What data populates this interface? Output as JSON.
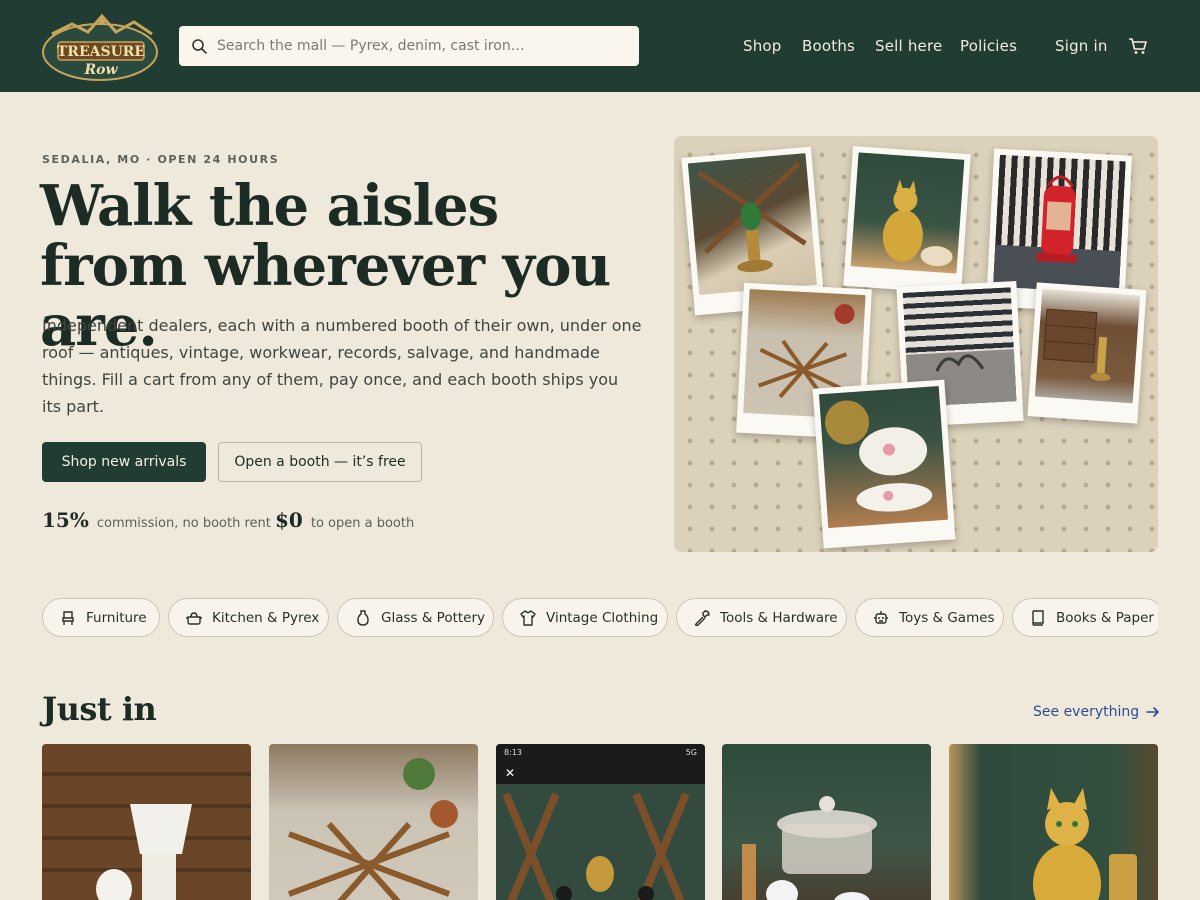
{
  "brand": {
    "logo_line1": "TREASURE",
    "logo_line2": "Row"
  },
  "search": {
    "placeholder": "Search the mall — Pyrex, denim, cast iron…",
    "icon": "search-icon"
  },
  "nav": {
    "items": [
      "Shop",
      "Booths",
      "Sell here",
      "Policies"
    ],
    "sign_in": "Sign in",
    "cart_icon": "cart-icon"
  },
  "hero": {
    "eyebrow": "SEDALIA, MO · OPEN 24 HOURS",
    "title": "Walk the aisles from wherever you are.",
    "description": "Independent dealers, each with a numbered booth of their own, under one roof — antiques, vintage, workwear, records, salvage, and handmade things. Fill a cart from any of them, pay once, and each booth ships you its part.",
    "primary_cta": "Shop new arrivals",
    "secondary_cta": "Open a booth — it’s free",
    "stats": [
      {
        "value": "15%",
        "label": "commission, no booth rent"
      },
      {
        "value": "$0",
        "label": "to open a booth"
      }
    ]
  },
  "categories": [
    {
      "label": "Furniture",
      "icon": "chair-icon"
    },
    {
      "label": "Kitchen & Pyrex",
      "icon": "pot-icon"
    },
    {
      "label": "Glass & Pottery",
      "icon": "vase-icon"
    },
    {
      "label": "Vintage Clothing",
      "icon": "shirt-icon"
    },
    {
      "label": "Tools & Hardware",
      "icon": "wrench-icon"
    },
    {
      "label": "Toys & Games",
      "icon": "robot-icon"
    },
    {
      "label": "Books & Paper",
      "icon": "book-icon"
    }
  ],
  "just_in": {
    "title": "Just in",
    "see_all": "See everything",
    "phone_time": "8:13",
    "phone_status": "5G"
  },
  "colors": {
    "header": "#213d33",
    "background": "#efe9dc",
    "link": "#2e4c8f",
    "pegboard": "#dcd2bb"
  }
}
